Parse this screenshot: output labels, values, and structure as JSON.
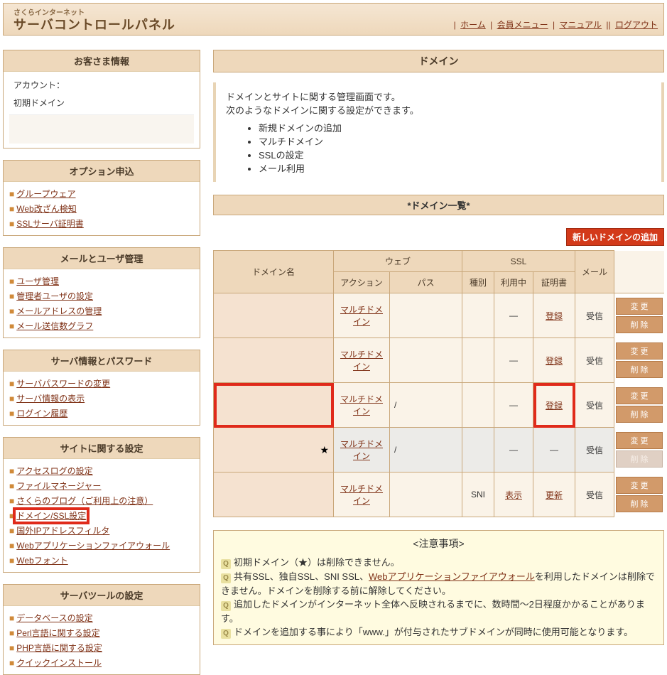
{
  "header": {
    "subtitle": "さくらインターネット",
    "title": "サーバコントロールパネル",
    "nav": {
      "home": "ホーム",
      "member": "会員メニュー",
      "manual": "マニュアル",
      "logout": "ログアウト"
    }
  },
  "sidebar": {
    "customer": {
      "title": "お客さま情報",
      "account_label": "アカウント：",
      "initdomain_label": "初期ドメイン"
    },
    "option": {
      "title": "オプション申込",
      "links": [
        "グループウェア",
        "Web改ざん検知",
        "SSLサーバ証明書"
      ]
    },
    "mail": {
      "title": "メールとユーザ管理",
      "links": [
        "ユーザ管理",
        "管理者ユーザの設定",
        "メールアドレスの管理",
        "メール送信数グラフ"
      ]
    },
    "server": {
      "title": "サーバ情報とパスワード",
      "links": [
        "サーバパスワードの変更",
        "サーバ情報の表示",
        "ログイン履歴"
      ]
    },
    "site": {
      "title": "サイトに関する設定",
      "links": [
        "アクセスログの設定",
        "ファイルマネージャー",
        "さくらのブログ（ご利用上の注意）",
        "ドメイン/SSL設定",
        "国外IPアドレスフィルタ",
        "Webアプリケーションファイアウォール",
        "Webフォント"
      ]
    },
    "tool": {
      "title": "サーバツールの設定",
      "links": [
        "データベースの設定",
        "Perl言語に関する設定",
        "PHP言語に関する設定",
        "クイックインストール"
      ]
    }
  },
  "main": {
    "page_title": "ドメイン",
    "intro1": "ドメインとサイトに関する管理画面です。",
    "intro2": "次のようなドメインに関する設定ができます。",
    "intro_items": [
      "新規ドメインの追加",
      "マルチドメイン",
      "SSLの設定",
      "メール利用"
    ],
    "list_title": "*ドメイン一覧*",
    "add_btn": "新しいドメインの追加",
    "th": {
      "domain": "ドメイン名",
      "web": "ウェブ",
      "action": "アクション",
      "path": "パス",
      "ssl": "SSL",
      "type": "種別",
      "inuse": "利用中",
      "cert": "証明書",
      "mail": "メール"
    },
    "multidomain": "マルチドメイン",
    "dash": "—",
    "slash": "/",
    "register": "登録",
    "show": "表示",
    "update": "更新",
    "receive": "受信",
    "sni": "SNI",
    "btn_change": "変 更",
    "btn_delete": "削 除",
    "notice": {
      "title": "<注意事項>",
      "n1": "初期ドメイン（★）は削除できません。",
      "n2a": "共有SSL、独自SSL、SNI SSL、",
      "n2link": "Webアプリケーションファイアウォール",
      "n2b": "を利用したドメインは削除できません。ドメインを削除する前に解除してください。",
      "n3": "追加したドメインがインターネット全体へ反映されるまでに、数時間～2日程度かかることがあります。",
      "n4": "ドメインを追加する事により「www.」が付与されたサブドメインが同時に使用可能となります。"
    }
  }
}
